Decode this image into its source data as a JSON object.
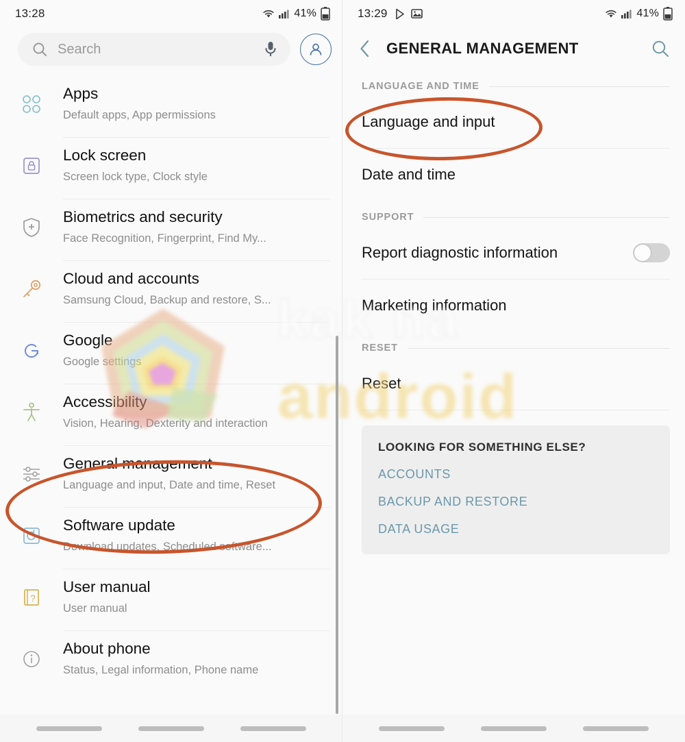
{
  "left_panel": {
    "statusbar": {
      "time": "13:28",
      "battery_text": "41%",
      "icons": [
        "wifi-icon",
        "signal-icon",
        "battery-icon"
      ]
    },
    "search": {
      "placeholder": "Search",
      "search_icon": "search-icon",
      "mic_icon": "microphone-icon",
      "avatar_icon": "account-avatar-icon"
    },
    "items": [
      {
        "icon": "apps-grid-icon",
        "title": "Apps",
        "subtitle": "Default apps, App permissions"
      },
      {
        "icon": "lock-icon",
        "title": "Lock screen",
        "subtitle": "Screen lock type, Clock style"
      },
      {
        "icon": "shield-plus-icon",
        "title": "Biometrics and security",
        "subtitle": "Face Recognition, Fingerprint, Find My..."
      },
      {
        "icon": "key-icon",
        "title": "Cloud and accounts",
        "subtitle": "Samsung Cloud, Backup and restore, S..."
      },
      {
        "icon": "google-g-icon",
        "title": "Google",
        "subtitle": "Google settings"
      },
      {
        "icon": "accessibility-icon",
        "title": "Accessibility",
        "subtitle": "Vision, Hearing, Dexterity and interaction"
      },
      {
        "icon": "sliders-icon",
        "title": "General management",
        "subtitle": "Language and input, Date and time, Reset"
      },
      {
        "icon": "software-update-icon",
        "title": "Software update",
        "subtitle": "Download updates, Scheduled software..."
      },
      {
        "icon": "user-manual-icon",
        "title": "User manual",
        "subtitle": "User manual"
      },
      {
        "icon": "info-icon",
        "title": "About phone",
        "subtitle": "Status, Legal information, Phone name"
      }
    ]
  },
  "right_panel": {
    "statusbar": {
      "time": "13:29",
      "battery_text": "41%",
      "icons": [
        "play-store-icon",
        "image-icon",
        "wifi-icon",
        "signal-icon",
        "battery-icon"
      ]
    },
    "appbar": {
      "back_icon": "back-chevron-icon",
      "title": "GENERAL MANAGEMENT",
      "search_icon": "search-icon"
    },
    "sections": [
      {
        "label": "LANGUAGE AND TIME",
        "rows": [
          {
            "title": "Language and input",
            "toggle": null
          },
          {
            "title": "Date and time",
            "toggle": null
          }
        ]
      },
      {
        "label": "SUPPORT",
        "rows": [
          {
            "title": "Report diagnostic information",
            "toggle": "off"
          },
          {
            "title": "Marketing information",
            "toggle": null
          }
        ]
      },
      {
        "label": "RESET",
        "rows": [
          {
            "title": "Reset",
            "toggle": null
          }
        ]
      }
    ],
    "card": {
      "title": "LOOKING FOR SOMETHING ELSE?",
      "links": [
        "ACCOUNTS",
        "BACKUP AND RESTORE",
        "DATA USAGE"
      ]
    }
  },
  "annotations": [
    {
      "name": "general-management-highlight",
      "color": "#c8552c",
      "shape": "ellipse"
    },
    {
      "name": "language-and-input-highlight",
      "color": "#c8552c",
      "shape": "ellipse"
    }
  ],
  "watermark": {
    "text_top": "kak na",
    "text_bottom": "android",
    "color_bottom": "#f2d47a"
  },
  "colors": {
    "accent_teal": "#6a98ab",
    "annotation_orange": "#c8552c",
    "icon_apps": "#8fc3cf",
    "icon_lock": "#9b93cf",
    "icon_shield": "#9b9b9b",
    "icon_key": "#e0a066",
    "icon_google": "#6f8fd4",
    "icon_accessibility": "#a7c48b",
    "icon_sliders": "#a0a0a0",
    "icon_update": "#8bb8d6",
    "icon_manual": "#d8b24e",
    "icon_info": "#a0a0a0"
  }
}
